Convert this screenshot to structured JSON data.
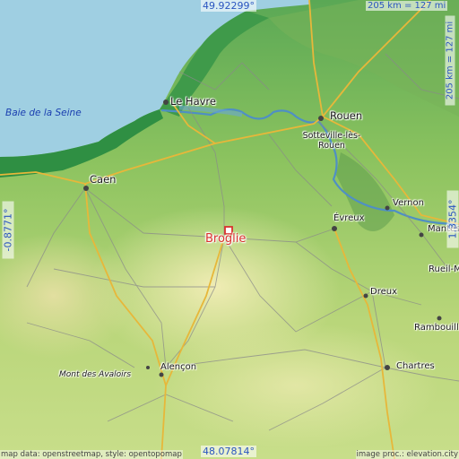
{
  "map": {
    "sea_name": "Baie de la Seine",
    "highlight": "Broglie",
    "places": {
      "le_havre": "Le Havre",
      "rouen": "Rouen",
      "sotteville": "Sotteville-lès-Rouen",
      "caen": "Caen",
      "evreux": "Évreux",
      "vernon": "Vernon",
      "mantes": "Mantes",
      "rueil": "Rueil-Ma",
      "dreux": "Dreux",
      "rambouillet": "Rambouill",
      "chartres": "Chartres",
      "alencon": "Alençon",
      "mont_avaloirs": "Mont des Avaloirs"
    },
    "coords": {
      "top": "49.92299°",
      "bottom": "48.07814°",
      "left": "-0.8771°",
      "right": "1.3354°"
    },
    "scale": {
      "top": "205 km = 127 mi",
      "right": "205 km = 127 mi"
    },
    "credits": {
      "left": "map data: openstreetmap, style: opentopomap",
      "right": "image proc.: elevation.city"
    },
    "colors": {
      "sea": "#9fcfe2",
      "lowland": "#2f8f43",
      "land": "#a6cd6a",
      "plateau": "#e7e9ab",
      "highlight": "#d9322e",
      "coords": "#2a55c0"
    }
  }
}
